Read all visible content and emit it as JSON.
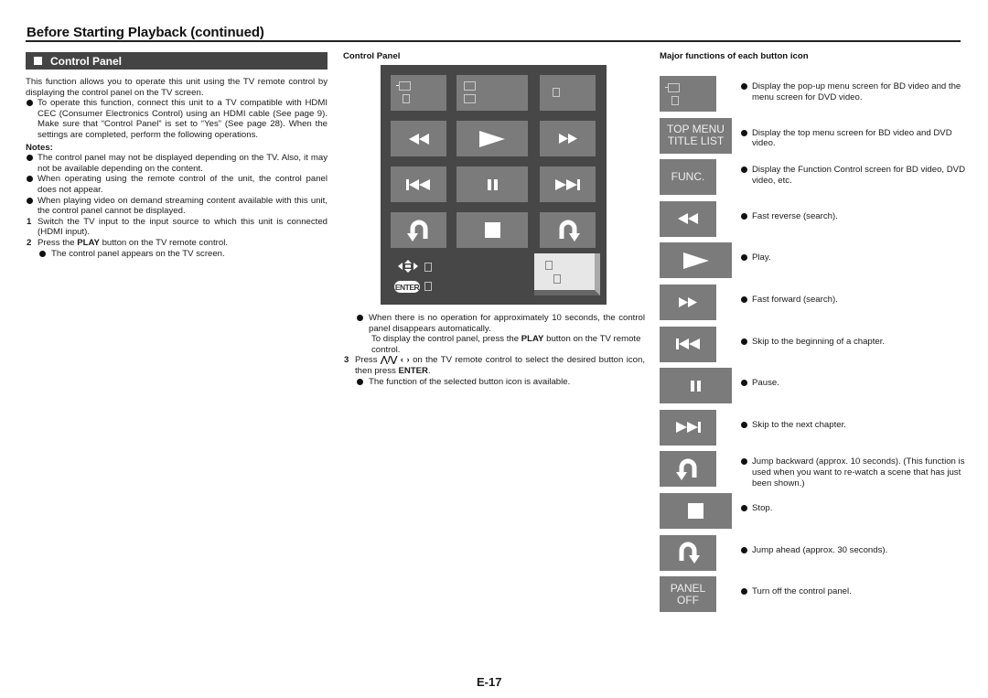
{
  "page_title": "Before Starting Playback (continued)",
  "section_heading": "Control Panel",
  "intro": "This function allows you to operate this unit using the TV remote control by displaying the control panel on the TV screen.",
  "intro_bullet": "To operate this function, connect this unit to a TV compatible with HDMI CEC (Consumer Electronics Control) using an HDMI cable (See page 9). Make sure that “Control Panel” is set to “Yes” (See page 28). When the settings are completed, perform the following operations.",
  "notes_heading": "Notes:",
  "notes": [
    "The control panel may not be displayed depending on the TV. Also, it may not be available depending on the content.",
    "When operating using the remote control of the unit, the control panel does not appear.",
    "When playing video on demand streaming content available with this unit, the control panel cannot be displayed."
  ],
  "steps": [
    {
      "num": "1",
      "text": "Switch the TV input to the input source to which this unit is connected (HDMI input)."
    },
    {
      "num": "2",
      "pre": "Press the ",
      "bold": "PLAY",
      "post": " button on the TV remote control.",
      "sub": "The control panel appears on the TV screen."
    },
    {
      "num": "3",
      "pre": "Press ",
      "arrows": "⋀/⋁ ‹ ›",
      "mid": " on the TV remote control to select the desired button icon, then press ",
      "bold": "ENTER",
      "post": ".",
      "sub": "The function of the selected button icon is available."
    }
  ],
  "middle": {
    "label": "Control Panel",
    "auto_hide_note": "When there is no operation for approximately 10 seconds, the control panel disappears automatically.",
    "redisplay_pre": "To display the control panel, press the ",
    "redisplay_bold": "PLAY",
    "redisplay_post": " button on the TV remote control.",
    "enter_label": "ENTER"
  },
  "legend": {
    "heading": "Major functions of each button icon",
    "items": [
      {
        "icon": "popup-menu-icon",
        "label": "",
        "desc": "Display the pop-up menu screen for BD video and the menu screen for DVD video."
      },
      {
        "icon": "top-menu-icon",
        "label": "TOP MENU\nTITLE LIST",
        "desc": "Display the top menu screen for BD video and DVD video."
      },
      {
        "icon": "function-icon",
        "label": "FUNC.",
        "desc": "Display the Function Control screen for BD video, DVD video, etc."
      },
      {
        "icon": "rewind-icon",
        "label": "",
        "desc": "Fast reverse (search)."
      },
      {
        "icon": "play-icon",
        "label": "",
        "desc": "Play."
      },
      {
        "icon": "fast-forward-icon",
        "label": "",
        "desc": "Fast forward (search)."
      },
      {
        "icon": "skip-back-icon",
        "label": "",
        "desc": "Skip to the beginning of a chapter."
      },
      {
        "icon": "pause-icon",
        "label": "",
        "desc": "Pause."
      },
      {
        "icon": "skip-forward-icon",
        "label": "",
        "desc": "Skip to the next chapter."
      },
      {
        "icon": "jump-back-icon",
        "label": "",
        "desc": "Jump backward (approx. 10 seconds). (This function is used when you want to re-watch a scene that has just been shown.)"
      },
      {
        "icon": "stop-icon",
        "label": "",
        "desc": "Stop."
      },
      {
        "icon": "jump-ahead-icon",
        "label": "",
        "desc": "Jump ahead (approx. 30 seconds)."
      },
      {
        "icon": "panel-off-icon",
        "label": "PANEL\nOFF",
        "desc": "Turn off the control panel."
      }
    ]
  },
  "page_number": "E-17"
}
